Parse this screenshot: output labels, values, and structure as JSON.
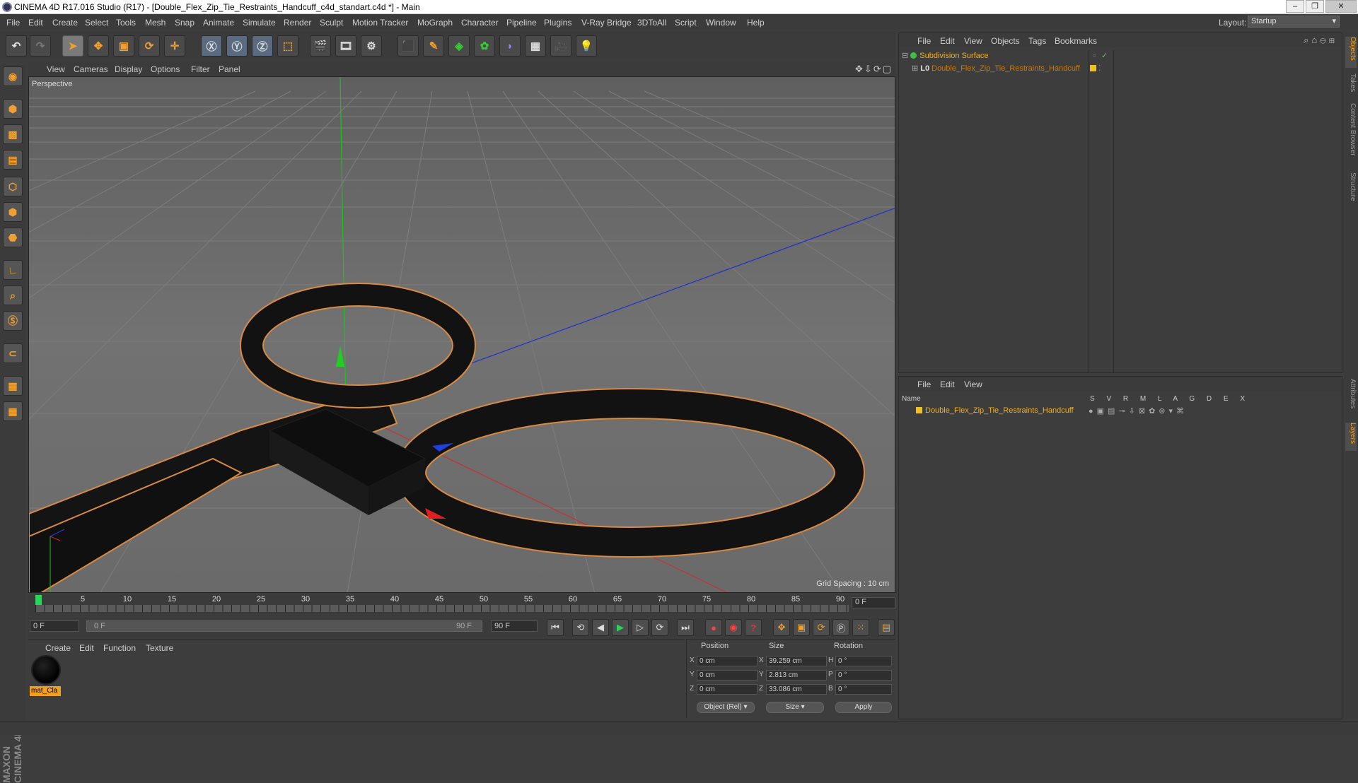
{
  "window": {
    "title": "CINEMA 4D R17.016 Studio (R17) - [Double_Flex_Zip_Tie_Restraints_Handcuff_c4d_standart.c4d *] - Main"
  },
  "menubar": {
    "items": [
      "File",
      "Edit",
      "Create",
      "Select",
      "Tools",
      "Mesh",
      "Snap",
      "Animate",
      "Simulate",
      "Render",
      "Sculpt",
      "Motion Tracker",
      "MoGraph",
      "Character",
      "Pipeline",
      "Plugins",
      "V-Ray Bridge",
      "3DToAll",
      "Script",
      "Window",
      "Help"
    ],
    "layout_label": "Layout:",
    "layout_value": "Startup"
  },
  "viewport": {
    "menu": [
      "View",
      "Cameras",
      "Display",
      "Options",
      "Filter",
      "Panel"
    ],
    "label": "Perspective",
    "grid_spacing": "Grid Spacing : 10 cm"
  },
  "timeline": {
    "ticks": [
      "0",
      "5",
      "10",
      "15",
      "20",
      "25",
      "30",
      "35",
      "40",
      "45",
      "50",
      "55",
      "60",
      "65",
      "70",
      "75",
      "80",
      "85",
      "90"
    ],
    "current_frame": "0 F",
    "start_field": "0 F",
    "range_start": "0 F",
    "range_end": "90 F",
    "end_field": "90 F"
  },
  "material_panel": {
    "menu": [
      "Create",
      "Edit",
      "Function",
      "Texture"
    ],
    "material_name": "mat_Cla"
  },
  "coords": {
    "headers": [
      "Position",
      "Size",
      "Rotation"
    ],
    "axes_pos": [
      "X",
      "Y",
      "Z"
    ],
    "axes_size": [
      "X",
      "Y",
      "Z"
    ],
    "axes_rot": [
      "H",
      "P",
      "B"
    ],
    "position": [
      "0 cm",
      "0 cm",
      "0 cm"
    ],
    "size": [
      "39.259 cm",
      "2.813 cm",
      "33.086 cm"
    ],
    "rotation": [
      "0 °",
      "0 °",
      "0 °"
    ],
    "mode": "Object (Rel)",
    "size_mode": "Size",
    "apply": "Apply"
  },
  "object_manager": {
    "menu": [
      "File",
      "Edit",
      "View",
      "Objects",
      "Tags",
      "Bookmarks"
    ],
    "rows": [
      {
        "name": "Subdivision Surface",
        "level": 0
      },
      {
        "name": "Double_Flex_Zip_Tie_Restraints_Handcuff",
        "level": 1
      }
    ]
  },
  "layer_manager": {
    "menu": [
      "File",
      "Edit",
      "View"
    ],
    "name_header": "Name",
    "columns": "S V R M L A G D E X",
    "row_name": "Double_Flex_Zip_Tie_Restraints_Handcuff"
  },
  "side_tabs": [
    "Objects",
    "Takes",
    "Content Browser",
    "Structure",
    "Attributes",
    "Layers"
  ],
  "brand": "MAXON CINEMA 4D",
  "colors": {
    "accent": "#f0a020",
    "selection": "#f0b020"
  }
}
